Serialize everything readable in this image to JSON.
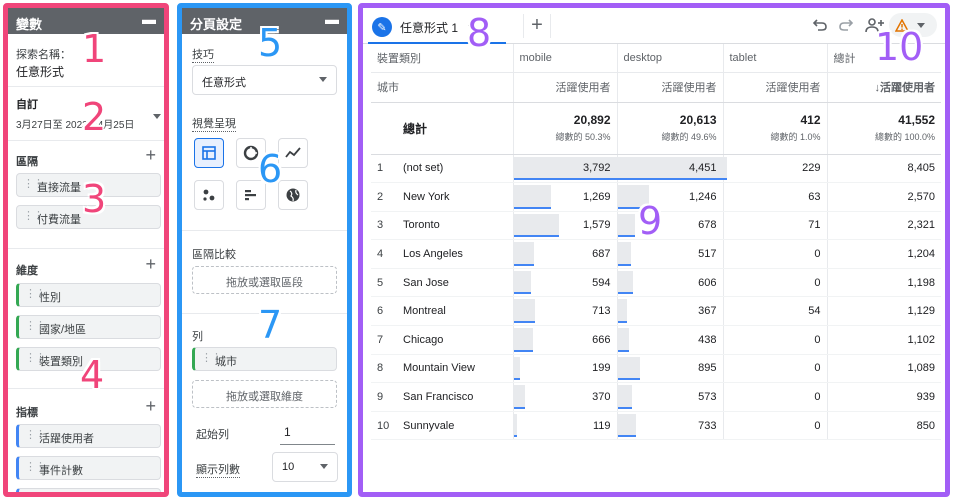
{
  "variables": {
    "title": "變數",
    "collapse_icon": "minimize-icon",
    "exploration_label": "探索名稱：",
    "exploration_name": "任意形式",
    "date_label": "自訂",
    "date_range": "3月27日至 2023年4月25日",
    "segments_title": "區隔",
    "segments": [
      "直接流量",
      "付費流量"
    ],
    "dimensions_title": "維度",
    "dimensions": [
      "性別",
      "國家/地區",
      "裝置類別"
    ],
    "metrics_title": "指標",
    "metrics": [
      "活躍使用者",
      "事件計數"
    ]
  },
  "tab_settings": {
    "title": "分頁設定",
    "technique_label": "技巧",
    "technique_value": "任意形式",
    "visualization_label": "視覺呈現",
    "segment_compare_label": "區隔比較",
    "segment_drop": "拖放或選取區段",
    "rows_label": "列",
    "row_dimension": "城市",
    "row_drop": "拖放或選取維度",
    "start_row_label": "起始列",
    "start_row_value": "1",
    "show_rows_label": "顯示列數",
    "show_rows_value": "10"
  },
  "report": {
    "tab_label": "任意形式 1",
    "device_header": "裝置類別",
    "city_header": "城市",
    "columns": [
      "mobile",
      "desktop",
      "tablet",
      "總計"
    ],
    "metric_header": "活躍使用者",
    "metric_header_sorted": "↓活躍使用者",
    "total_label": "總計",
    "totals": [
      {
        "value": "20,892",
        "pct": "總數的 50.3%"
      },
      {
        "value": "20,613",
        "pct": "總數的 49.6%"
      },
      {
        "value": "412",
        "pct": "總數的 1.0%"
      },
      {
        "value": "41,552",
        "pct": "總數的 100.0%"
      }
    ],
    "rows": [
      {
        "idx": "1",
        "city": "(not set)",
        "mobile": "3,792",
        "desktop": "4,451",
        "tablet": "229",
        "total": "8,405"
      },
      {
        "idx": "2",
        "city": "New York",
        "mobile": "1,269",
        "desktop": "1,246",
        "tablet": "63",
        "total": "2,570"
      },
      {
        "idx": "3",
        "city": "Toronto",
        "mobile": "1,579",
        "desktop": "678",
        "tablet": "71",
        "total": "2,321"
      },
      {
        "idx": "4",
        "city": "Los Angeles",
        "mobile": "687",
        "desktop": "517",
        "tablet": "0",
        "total": "1,204"
      },
      {
        "idx": "5",
        "city": "San Jose",
        "mobile": "594",
        "desktop": "606",
        "tablet": "0",
        "total": "1,198"
      },
      {
        "idx": "6",
        "city": "Montreal",
        "mobile": "713",
        "desktop": "367",
        "tablet": "54",
        "total": "1,129"
      },
      {
        "idx": "7",
        "city": "Chicago",
        "mobile": "666",
        "desktop": "438",
        "tablet": "0",
        "total": "1,102"
      },
      {
        "idx": "8",
        "city": "Mountain View",
        "mobile": "199",
        "desktop": "895",
        "tablet": "0",
        "total": "1,089"
      },
      {
        "idx": "9",
        "city": "San Francisco",
        "mobile": "370",
        "desktop": "573",
        "tablet": "0",
        "total": "939"
      },
      {
        "idx": "10",
        "city": "Sunnyvale",
        "mobile": "119",
        "desktop": "733",
        "tablet": "0",
        "total": "850"
      }
    ]
  },
  "annotations": [
    "1",
    "2",
    "3",
    "4",
    "5",
    "6",
    "7",
    "8",
    "9",
    "10"
  ],
  "colors": {
    "variables_frame": "#f0457a",
    "tab_settings_frame": "#2b97f5",
    "report_frame": "#a25ef6",
    "accent": "#1a73e8",
    "bar": "#e8eaed",
    "warning": "#e37400"
  }
}
